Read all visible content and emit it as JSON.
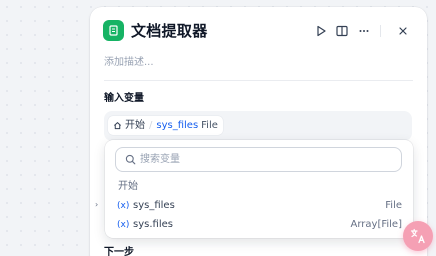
{
  "node": {
    "title": "文档提取器",
    "description_placeholder": "添加描述...",
    "icon": "document-icon",
    "icon_color": "#16b364"
  },
  "header_actions": [
    "run-icon",
    "split-view-icon",
    "more-icon",
    "close-icon"
  ],
  "input_section": {
    "label": "输入变量",
    "selected": {
      "node_icon": "home-icon",
      "node_name": "开始",
      "variable": "sys_files",
      "type": "File"
    }
  },
  "next_section": {
    "label": "下一步"
  },
  "dropdown": {
    "search_placeholder": "搜索变量",
    "group": "开始",
    "options": [
      {
        "icon": "(x)",
        "name": "sys_files",
        "type": "File"
      },
      {
        "icon": "(x)",
        "name": "sys.files",
        "type": "Array[File]"
      }
    ]
  },
  "colors": {
    "accent": "#155eef",
    "node_green": "#16b364",
    "fab_pink": "#f5a0b4"
  }
}
